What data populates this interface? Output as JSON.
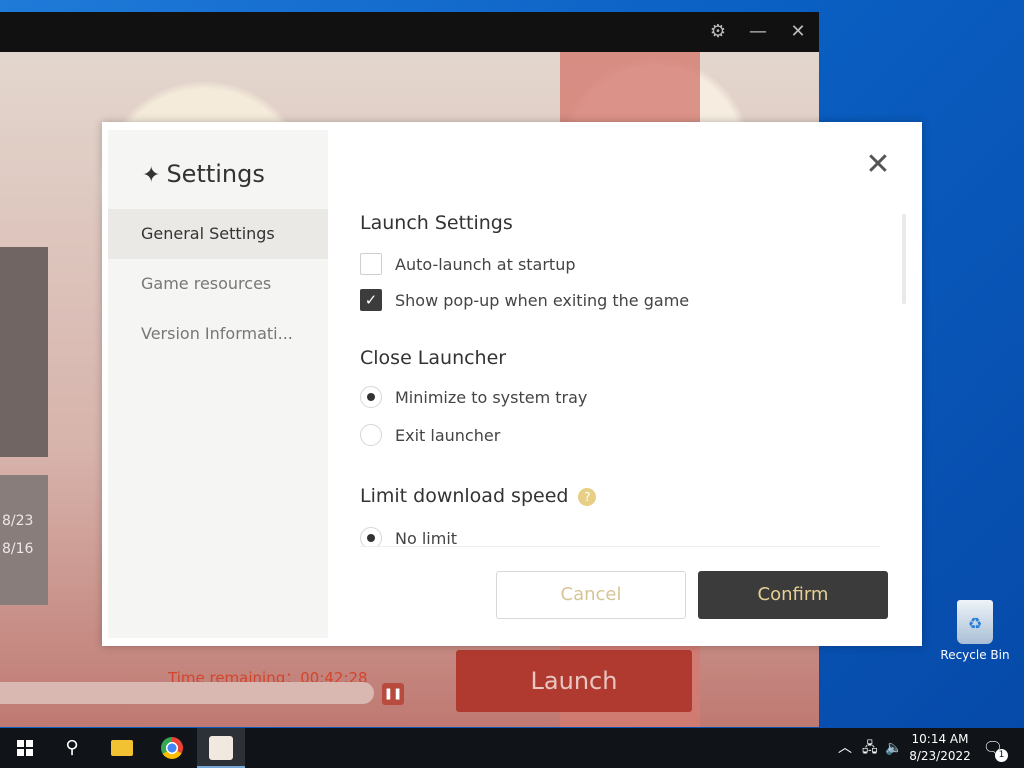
{
  "launcher": {
    "time_remaining": "Time remaining：00:42:28",
    "launch_label": "Launch",
    "date1": "8/23",
    "date2": "8/16",
    "progress_fraction": 0.0
  },
  "dialog": {
    "title": "Settings",
    "sidebar": [
      {
        "label": "General Settings",
        "active": true
      },
      {
        "label": "Game resources",
        "active": false
      },
      {
        "label": "Version Informati...",
        "active": false
      }
    ],
    "launch_settings": {
      "title": "Launch Settings",
      "options": [
        {
          "label": "Auto-launch at startup",
          "checked": false
        },
        {
          "label": "Show pop-up when exiting the game",
          "checked": true
        }
      ]
    },
    "close_launcher": {
      "title": "Close Launcher",
      "options": [
        {
          "label": "Minimize to system tray",
          "selected": true
        },
        {
          "label": "Exit launcher",
          "selected": false
        }
      ]
    },
    "download_speed": {
      "title": "Limit download speed",
      "help_icon": "?",
      "options": [
        {
          "label": "No limit",
          "selected": true
        }
      ]
    },
    "cancel_label": "Cancel",
    "confirm_label": "Confirm"
  },
  "desktop": {
    "recycle_bin_label": "Recycle Bin"
  },
  "taskbar": {
    "time": "10:14 AM",
    "date": "8/23/2022",
    "notification_count": "1"
  }
}
